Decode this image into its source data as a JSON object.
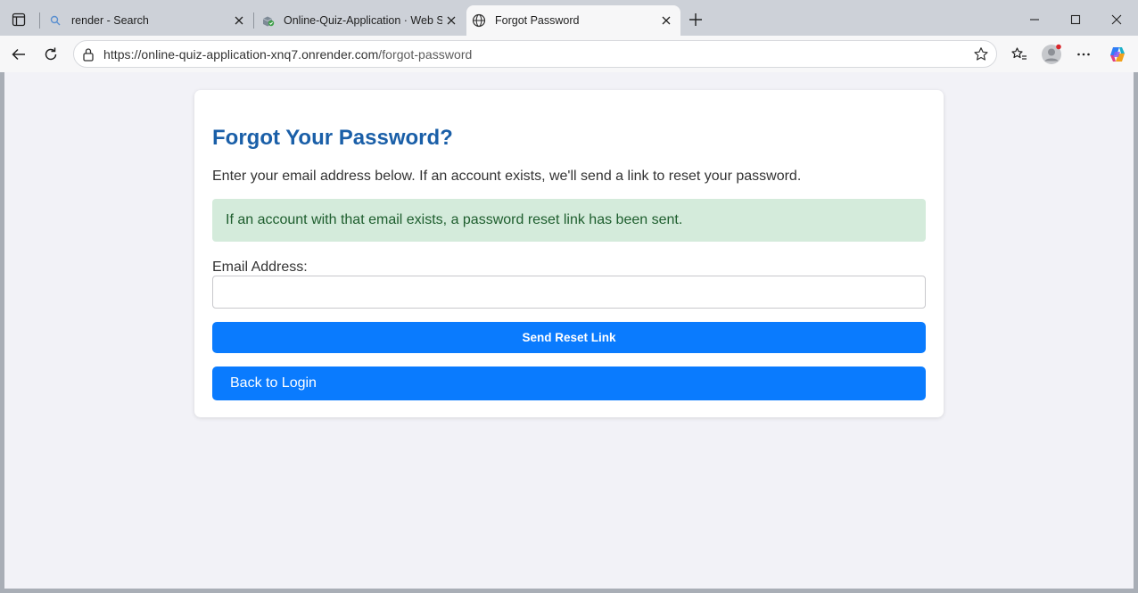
{
  "tabs": [
    {
      "title": "render - Search",
      "favicon": "search-icon",
      "active": false
    },
    {
      "title": "Online-Quiz-Application · Web Se",
      "favicon": "render-cube-icon",
      "active": false
    },
    {
      "title": "Forgot Password",
      "favicon": "globe-icon",
      "active": true
    }
  ],
  "address_bar": {
    "url_host": "https://online-quiz-application-xnq7.onrender.com",
    "url_path": "/forgot-password"
  },
  "page": {
    "heading": "Forgot Your Password?",
    "intro": "Enter your email address below. If an account exists, we'll send a link to reset your password.",
    "alert_message": "If an account with that email exists, a password reset link has been sent.",
    "email_label": "Email Address:",
    "email_value": "",
    "email_placeholder": "",
    "send_button": "Send Reset Link",
    "back_link": "Back to Login"
  },
  "colors": {
    "heading": "#1a5fa8",
    "primary_button": "#0a7bfe",
    "alert_bg": "#d4ebdb",
    "alert_text": "#1e5e2e",
    "page_bg": "#f2f2f7"
  }
}
